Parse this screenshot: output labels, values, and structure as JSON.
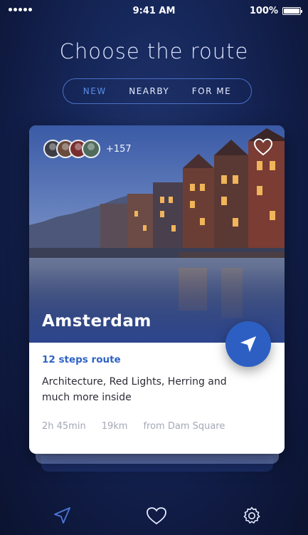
{
  "status_bar": {
    "time": "9:41 AM",
    "battery": "100%"
  },
  "header": {
    "title": "Choose the route"
  },
  "tabs": [
    {
      "label": "NEW",
      "active": true
    },
    {
      "label": "NEARBY",
      "active": false
    },
    {
      "label": "FOR ME",
      "active": false
    }
  ],
  "card": {
    "avatars_extra": "+157",
    "city": "Amsterdam",
    "steps": "12 steps route",
    "description": "Architecture, Red Lights, Herring and much more inside",
    "duration": "2h 45min",
    "distance": "19km",
    "start": "from Dam Square"
  },
  "icons": {
    "favorite": "heart-icon",
    "navigate": "navigation-arrow-icon",
    "tab_routes": "navigation-icon",
    "tab_favorites": "heart-icon",
    "tab_settings": "gear-icon"
  },
  "colors": {
    "accent": "#2d5fc3",
    "active_tab": "#5b8ee8",
    "background": "#16275a"
  }
}
